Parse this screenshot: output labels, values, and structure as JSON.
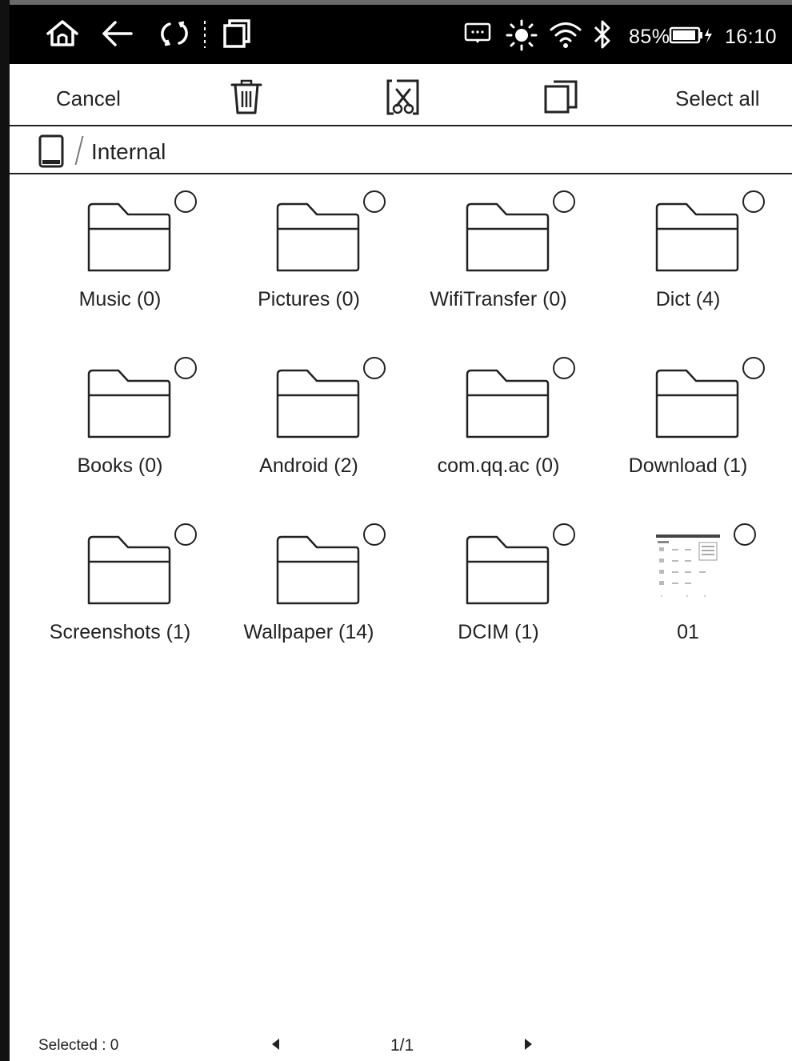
{
  "status_bar": {
    "battery_percent": "85%",
    "time": "16:10",
    "icons": [
      "home-icon",
      "back-icon",
      "refresh-icon",
      "recent-apps-icon",
      "keyboard-icon",
      "brightness-icon",
      "wifi-icon",
      "bluetooth-icon",
      "battery-charging-icon"
    ]
  },
  "toolbar": {
    "cancel_label": "Cancel",
    "select_all_label": "Select all",
    "icons": [
      "delete-icon",
      "cut-icon",
      "copy-icon"
    ]
  },
  "breadcrumb": {
    "location": "Internal",
    "icon": "tablet-device-icon"
  },
  "items": [
    {
      "label": "Music (0)",
      "type": "folder",
      "selected": false
    },
    {
      "label": "Pictures (0)",
      "type": "folder",
      "selected": false
    },
    {
      "label": "WifiTransfer (0)",
      "type": "folder",
      "selected": false
    },
    {
      "label": "Dict (4)",
      "type": "folder",
      "selected": false
    },
    {
      "label": "Books (0)",
      "type": "folder",
      "selected": false
    },
    {
      "label": "Android (2)",
      "type": "folder",
      "selected": false
    },
    {
      "label": "com.qq.ac (0)",
      "type": "folder",
      "selected": false
    },
    {
      "label": "Download (1)",
      "type": "folder",
      "selected": false
    },
    {
      "label": "Screenshots (1)",
      "type": "folder",
      "selected": false
    },
    {
      "label": "Wallpaper (14)",
      "type": "folder",
      "selected": false
    },
    {
      "label": "DCIM (1)",
      "type": "folder",
      "selected": false
    },
    {
      "label": "01",
      "type": "image",
      "selected": false
    }
  ],
  "footer": {
    "selected_text": "Selected : 0",
    "page_indicator": "1/1"
  }
}
